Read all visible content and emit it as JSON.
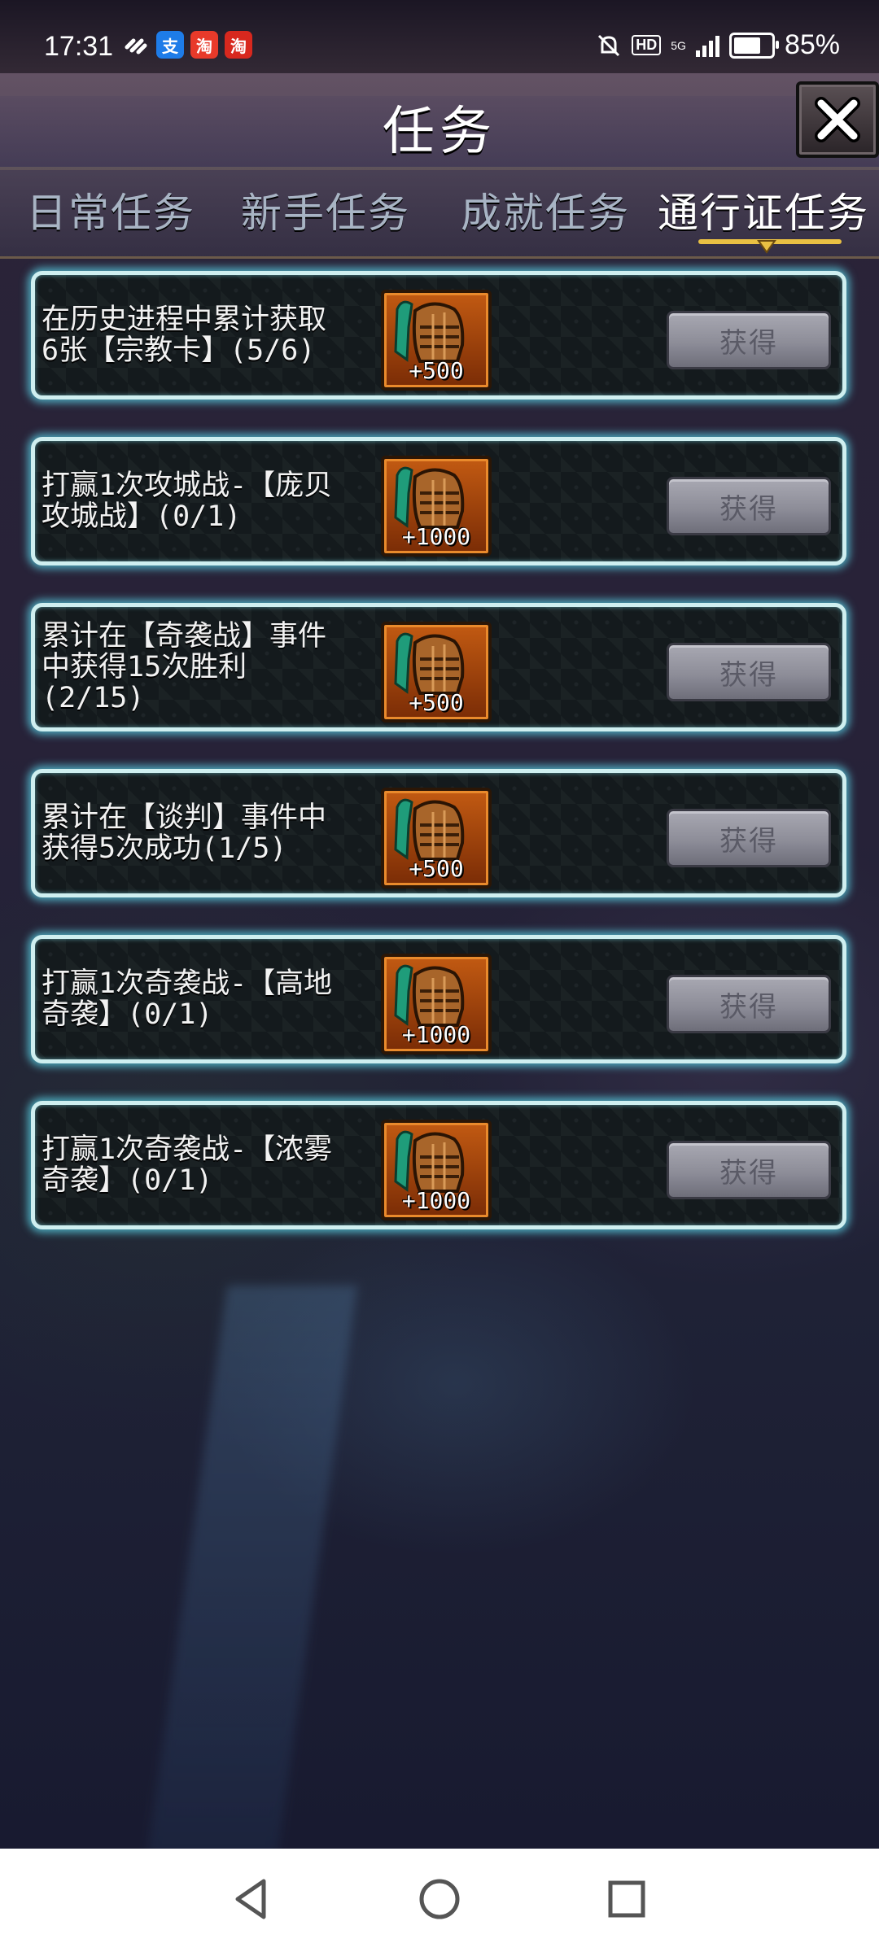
{
  "status_bar": {
    "time": "17:31",
    "apps": [
      "支",
      "淘",
      "淘"
    ],
    "hd": "HD",
    "network": "5G",
    "battery": "85%",
    "battery_level": 0.85
  },
  "header": {
    "title": "任务",
    "close_icon": "close-x-icon"
  },
  "tabs": [
    {
      "label": "日常任务",
      "active": false
    },
    {
      "label": "新手任务",
      "active": false
    },
    {
      "label": "成就任务",
      "active": false
    },
    {
      "label": "通行证任务",
      "active": true
    }
  ],
  "tasks": [
    {
      "text": "在历史进程中累计获取\n6张【宗教卡】(5/6)",
      "reward": "+500",
      "button": "获得"
    },
    {
      "text": "打赢1次攻城战-【庞贝\n攻城战】(0/1)",
      "reward": "+1000",
      "button": "获得"
    },
    {
      "text": "累计在【奇袭战】事件\n中获得15次胜利\n(2/15)",
      "reward": "+500",
      "button": "获得"
    },
    {
      "text": "累计在【谈判】事件中\n获得5次成功(1/5)",
      "reward": "+500",
      "button": "获得"
    },
    {
      "text": "打赢1次奇袭战-【高地\n奇袭】(0/1)",
      "reward": "+1000",
      "button": "获得"
    },
    {
      "text": "打赢1次奇袭战-【浓雾\n奇袭】(0/1)",
      "reward": "+1000",
      "button": "获得"
    }
  ],
  "reward_icon": "helmet-icon",
  "nav": [
    "back-icon",
    "home-icon",
    "recents-icon"
  ],
  "colors": {
    "card_border": "#cfeff0",
    "card_glow": "#5ad2e6",
    "tab_active_underline": "#e9c043",
    "reward_bg": "#c25a12",
    "button_bg": "#8d8d98"
  }
}
